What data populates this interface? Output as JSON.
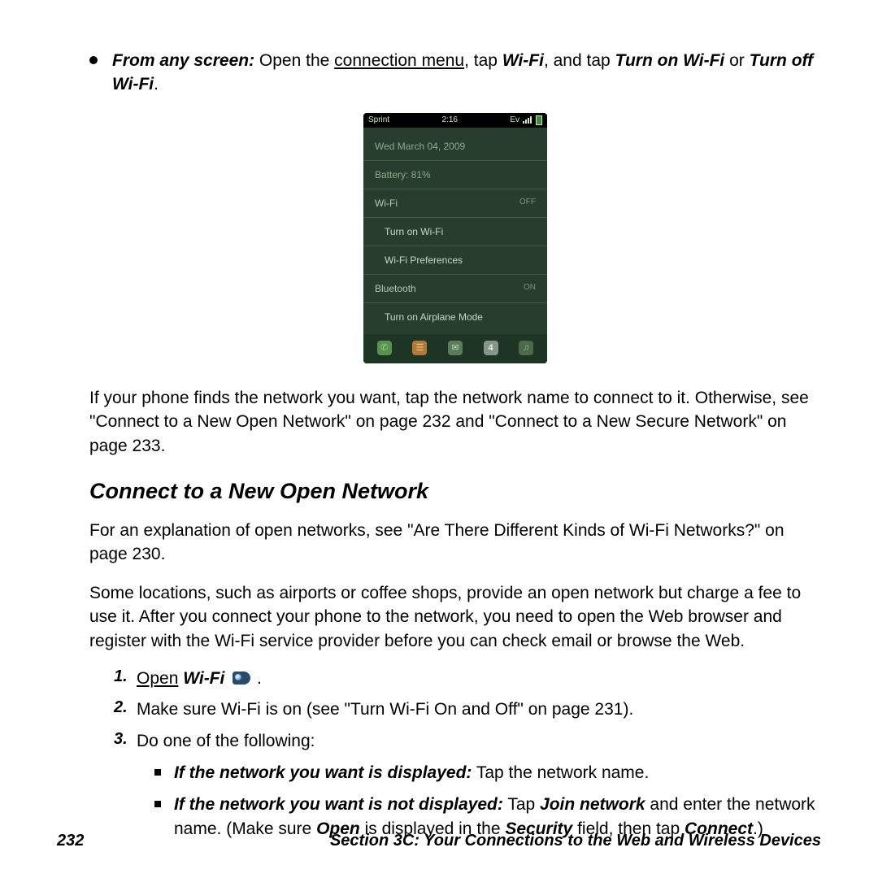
{
  "top_bullet": {
    "lead": "From any screen:",
    "t1": " Open the ",
    "link": "connection menu",
    "t2": ", tap ",
    "wifi": "Wi-Fi",
    "t3": ", and tap ",
    "on": "Turn on Wi-Fi",
    "t4": " or ",
    "off": "Turn off Wi-Fi",
    "t5": "."
  },
  "phone": {
    "carrier": "Sprint",
    "time": "2:16",
    "ev": "Ev",
    "date": "Wed March 04, 2009",
    "battery": "Battery: 81%",
    "wifi_label": "Wi-Fi",
    "wifi_state": "OFF",
    "turn_on": "Turn on Wi-Fi",
    "wifi_prefs": "Wi-Fi Preferences",
    "bt_label": "Bluetooth",
    "bt_state": "ON",
    "airplane": "Turn on Airplane Mode",
    "cal_badge": "4"
  },
  "para_found": "If your phone finds the network you want, tap the network name to connect to it. Otherwise, see \"Connect to a New Open Network\" on page 232 and \"Connect to a New Secure Network\" on page 233.",
  "heading": "Connect to a New Open Network",
  "para_explain": "For an explanation of open networks, see \"Are There Different Kinds of Wi-Fi Networks?\" on page 230.",
  "para_fee": "Some locations, such as airports or coffee shops, provide an open network but charge a fee to use it. After you connect your phone to the network, you need to open the Web browser and register with the Wi-Fi service provider before you can check email or browse the Web.",
  "steps": {
    "s1_open": "Open",
    "s1_wifi": "Wi-Fi",
    "s1_tail": " .",
    "s2": "Make sure Wi-Fi is on (see \"Turn Wi-Fi On and Off\" on page 231).",
    "s3": "Do one of the following:"
  },
  "sub": {
    "a_lead": "If the network you want is displayed:",
    "a_text": " Tap the network name.",
    "b_lead": "If the network you want is not displayed:",
    "b_t1": " Tap ",
    "b_join": "Join network",
    "b_t2": " and enter the network name. (Make sure ",
    "b_open": "Open",
    "b_t3": " is displayed in the ",
    "b_sec": "Security",
    "b_t4": " field, then tap ",
    "b_conn": "Connect",
    "b_t5": ".)"
  },
  "footer": {
    "page": "232",
    "section": "Section 3C: Your Connections to the Web and Wireless Devices"
  }
}
